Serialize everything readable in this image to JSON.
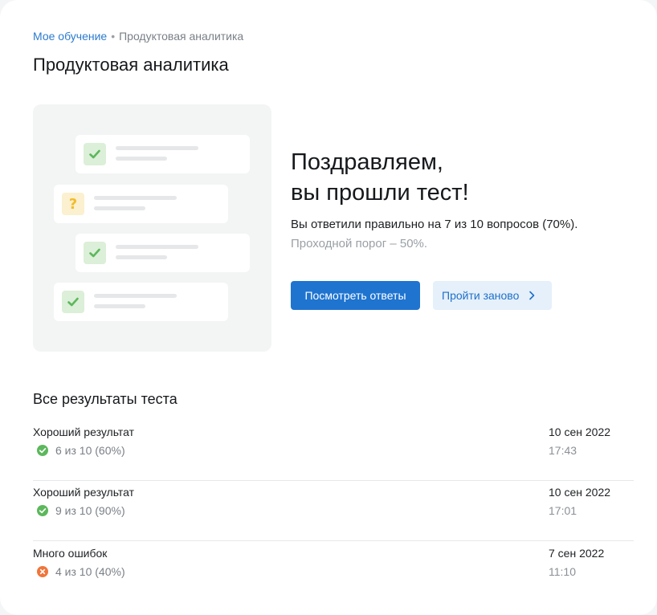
{
  "breadcrumb": {
    "parent": "Мое обучение",
    "separator": "•",
    "current": "Продуктовая аналитика"
  },
  "page_title": "Продуктовая аналитика",
  "illustration": {
    "cards": [
      {
        "icon": "check-icon"
      },
      {
        "icon": "question-icon",
        "symbol": "?"
      },
      {
        "icon": "check-icon"
      },
      {
        "icon": "check-icon"
      }
    ]
  },
  "congrats": {
    "line1": "Поздравляем,",
    "line2": "вы прошли тест!",
    "result": "Вы ответили правильно на 7 из 10 вопросов (70%).",
    "threshold": "Проходной порог – 50%."
  },
  "actions": {
    "view_answers": "Посмотреть ответы",
    "retake": "Пройти заново"
  },
  "results": {
    "title": "Все результаты теста",
    "items": [
      {
        "title": "Хороший результат",
        "status": "success",
        "score": "6 из 10 (60%)",
        "date": "10 сен 2022",
        "time": "17:43"
      },
      {
        "title": "Хороший результат",
        "status": "success",
        "score": "9 из 10 (90%)",
        "date": "10 сен 2022",
        "time": "17:01"
      },
      {
        "title": "Много ошибок",
        "status": "error",
        "score": "4 из 10 (40%)",
        "date": "7 сен 2022",
        "time": "11:10"
      }
    ]
  },
  "colors": {
    "accent": "#1f74d0",
    "success": "#5cb85c",
    "error": "#f0753a",
    "warning": "#f1bd2c"
  }
}
